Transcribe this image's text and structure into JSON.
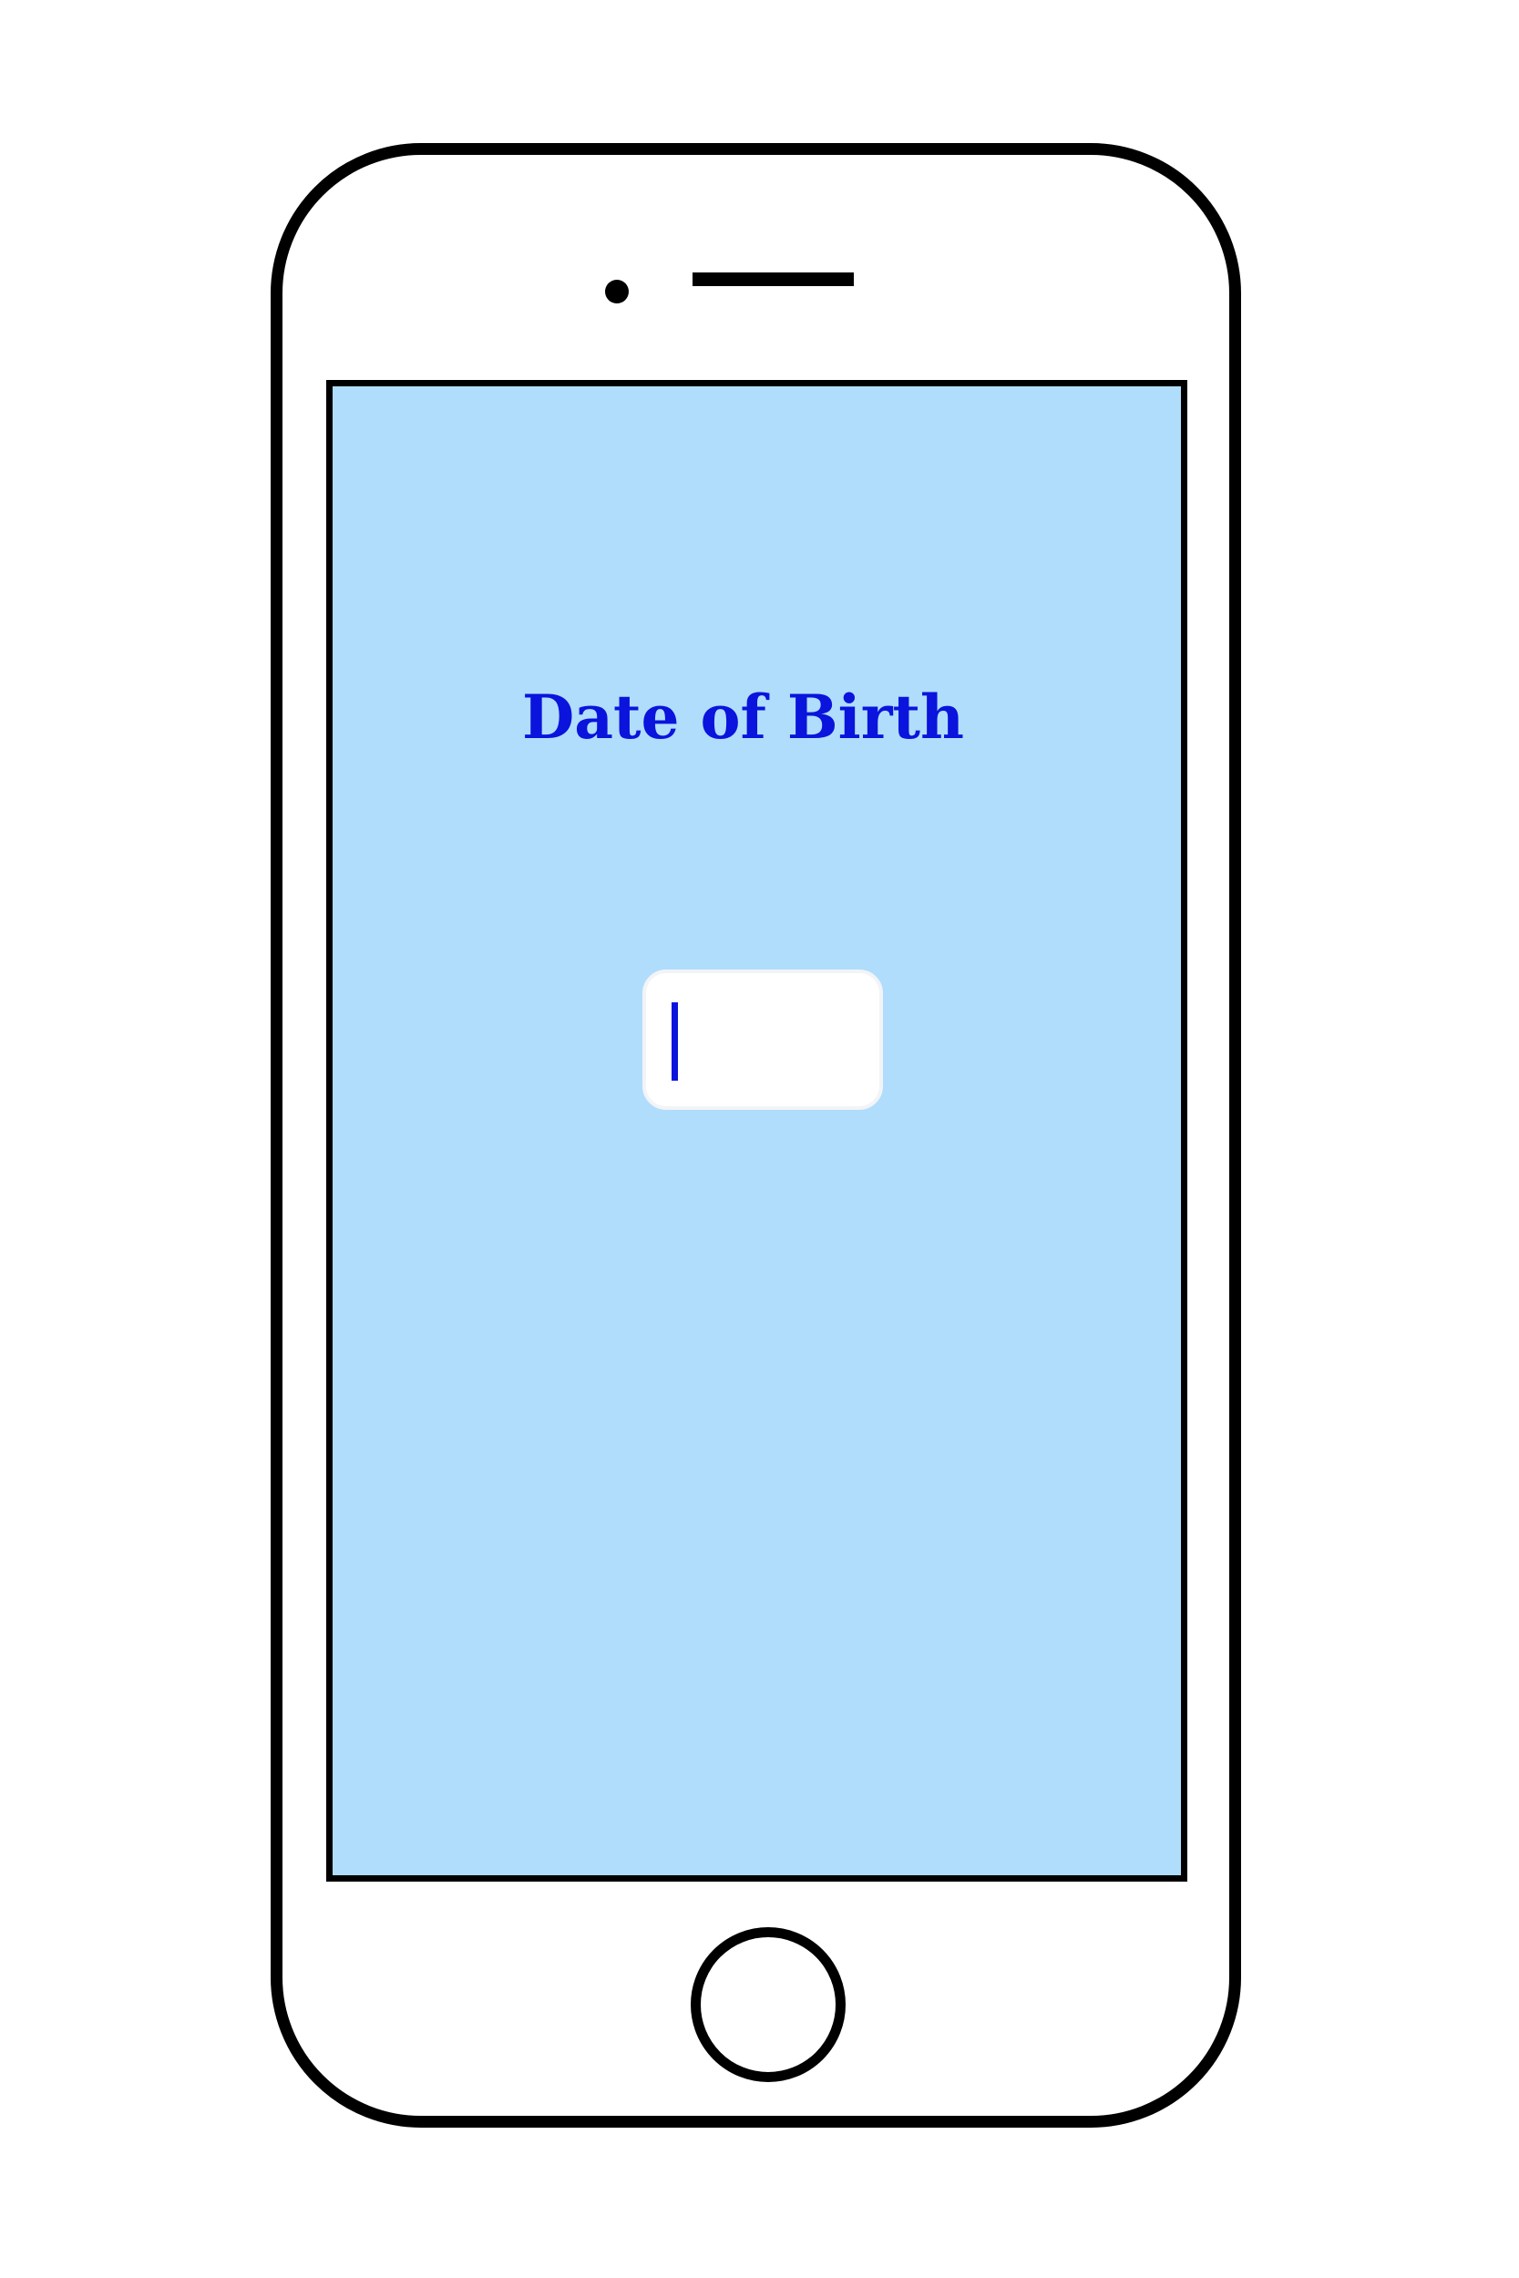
{
  "screen": {
    "title": "Date of Birth",
    "dob_input": {
      "value": "",
      "focused": true
    }
  },
  "colors": {
    "screen_background": "#b0ddfb",
    "title_text": "#0a14dc",
    "cursor": "#0a14dc",
    "device_outline": "#000000",
    "input_background": "#ffffff"
  }
}
